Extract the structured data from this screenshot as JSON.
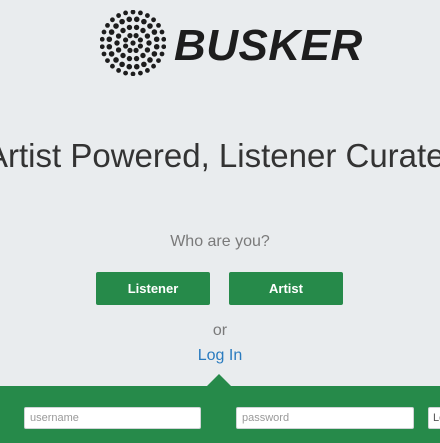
{
  "brand": {
    "name": "BUSKER",
    "logo_icon": "dotted-circle-icon"
  },
  "hero": {
    "headline": "Artist Powered, Listener Curated"
  },
  "role_select": {
    "prompt": "Who are you?",
    "listener_label": "Listener",
    "artist_label": "Artist",
    "or_text": "or",
    "login_link": "Log In"
  },
  "login_bar": {
    "username_placeholder": "username",
    "password_placeholder": "password",
    "submit_partial": "Lo"
  },
  "colors": {
    "accent_green": "#268a4a",
    "link_blue": "#2a7bbf",
    "background": "#e9ecee"
  }
}
